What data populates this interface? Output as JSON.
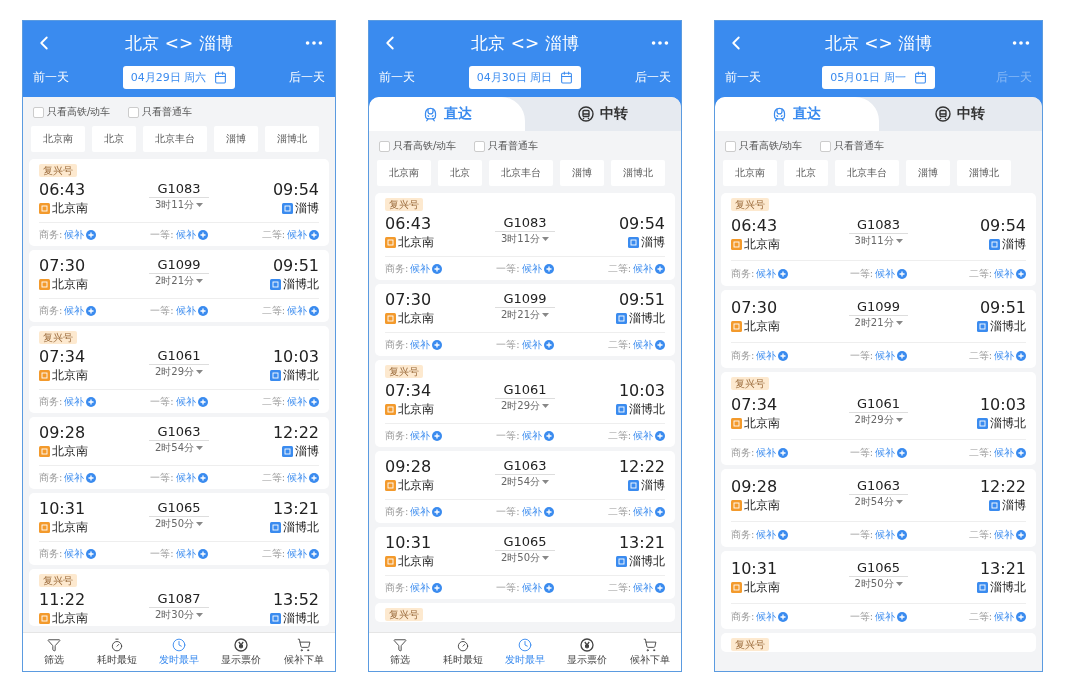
{
  "screens": [
    {
      "title": "北京 <> 淄博",
      "prev_day": {
        "label": "前一天",
        "disabled": false
      },
      "date": "04月29日 周六",
      "next_day": {
        "label": "后一天",
        "disabled": false
      },
      "filters": [
        {
          "label": "只看高铁/动车",
          "checked": false
        },
        {
          "label": "只看普通车",
          "checked": false
        }
      ],
      "stations": [
        "北京南",
        "北京",
        "北京丰台",
        "淄博",
        "淄博北"
      ],
      "trains": [
        {
          "badge": "复兴号",
          "depart": "06:43",
          "from": {
            "name": "北京南",
            "kind": "origin"
          },
          "number": "G1083",
          "duration": "3时11分",
          "arrive": "09:54",
          "to": {
            "name": "淄博",
            "kind": "pass"
          },
          "seats": [
            {
              "label": "商务:",
              "status": "候补"
            },
            {
              "label": "一等:",
              "status": "候补"
            },
            {
              "label": "二等:",
              "status": "候补"
            }
          ]
        },
        {
          "depart": "07:30",
          "from": {
            "name": "北京南",
            "kind": "origin"
          },
          "number": "G1099",
          "duration": "2时21分",
          "arrive": "09:51",
          "to": {
            "name": "淄博北",
            "kind": "pass"
          },
          "seats": [
            {
              "label": "商务:",
              "status": "候补"
            },
            {
              "label": "一等:",
              "status": "候补"
            },
            {
              "label": "二等:",
              "status": "候补"
            }
          ]
        },
        {
          "badge": "复兴号",
          "depart": "07:34",
          "from": {
            "name": "北京南",
            "kind": "origin"
          },
          "number": "G1061",
          "duration": "2时29分",
          "arrive": "10:03",
          "to": {
            "name": "淄博北",
            "kind": "pass"
          },
          "seats": [
            {
              "label": "商务:",
              "status": "候补"
            },
            {
              "label": "一等:",
              "status": "候补"
            },
            {
              "label": "二等:",
              "status": "候补"
            }
          ]
        },
        {
          "depart": "09:28",
          "from": {
            "name": "北京南",
            "kind": "origin"
          },
          "number": "G1063",
          "duration": "2时54分",
          "arrive": "12:22",
          "to": {
            "name": "淄博",
            "kind": "pass"
          },
          "seats": [
            {
              "label": "商务:",
              "status": "候补"
            },
            {
              "label": "一等:",
              "status": "候补"
            },
            {
              "label": "二等:",
              "status": "候补"
            }
          ]
        },
        {
          "depart": "10:31",
          "from": {
            "name": "北京南",
            "kind": "origin"
          },
          "number": "G1065",
          "duration": "2时50分",
          "arrive": "13:21",
          "to": {
            "name": "淄博北",
            "kind": "pass"
          },
          "seats": [
            {
              "label": "商务:",
              "status": "候补"
            },
            {
              "label": "一等:",
              "status": "候补"
            },
            {
              "label": "二等:",
              "status": "候补"
            }
          ]
        },
        {
          "badge": "复兴号",
          "depart": "11:22",
          "from": {
            "name": "北京南",
            "kind": "origin"
          },
          "number": "G1087",
          "duration": "2时30分",
          "arrive": "13:52",
          "to": {
            "name": "淄博北",
            "kind": "pass"
          }
        }
      ],
      "bottom_nav": [
        {
          "kind": "filter",
          "label": "筛选",
          "selected": false
        },
        {
          "kind": "duration",
          "label": "耗时最短",
          "selected": false
        },
        {
          "kind": "depart",
          "label": "发时最早",
          "selected": true
        },
        {
          "kind": "price",
          "label": "显示票价",
          "selected": false
        },
        {
          "kind": "cart",
          "label": "候补下单",
          "selected": false
        }
      ]
    },
    {
      "title": "北京 <> 淄博",
      "prev_day": {
        "label": "前一天",
        "disabled": false
      },
      "date": "04月30日 周日",
      "next_day": {
        "label": "后一天",
        "disabled": false
      },
      "tabs": [
        {
          "kind": "direct",
          "label": "直达",
          "selected": true
        },
        {
          "kind": "transfer",
          "label": "中转",
          "selected": false
        }
      ],
      "filters": [
        {
          "label": "只看高铁/动车",
          "checked": false
        },
        {
          "label": "只看普通车",
          "checked": false
        }
      ],
      "stations": [
        "北京南",
        "北京",
        "北京丰台",
        "淄博",
        "淄博北"
      ],
      "trains": [
        {
          "badge": "复兴号",
          "depart": "06:43",
          "from": {
            "name": "北京南",
            "kind": "origin"
          },
          "number": "G1083",
          "duration": "3时11分",
          "arrive": "09:54",
          "to": {
            "name": "淄博",
            "kind": "pass"
          },
          "seats": [
            {
              "label": "商务:",
              "status": "候补"
            },
            {
              "label": "一等:",
              "status": "候补"
            },
            {
              "label": "二等:",
              "status": "候补"
            }
          ]
        },
        {
          "depart": "07:30",
          "from": {
            "name": "北京南",
            "kind": "origin"
          },
          "number": "G1099",
          "duration": "2时21分",
          "arrive": "09:51",
          "to": {
            "name": "淄博北",
            "kind": "pass"
          },
          "seats": [
            {
              "label": "商务:",
              "status": "候补"
            },
            {
              "label": "一等:",
              "status": "候补"
            },
            {
              "label": "二等:",
              "status": "候补"
            }
          ]
        },
        {
          "badge": "复兴号",
          "depart": "07:34",
          "from": {
            "name": "北京南",
            "kind": "origin"
          },
          "number": "G1061",
          "duration": "2时29分",
          "arrive": "10:03",
          "to": {
            "name": "淄博北",
            "kind": "pass"
          },
          "seats": [
            {
              "label": "商务:",
              "status": "候补"
            },
            {
              "label": "一等:",
              "status": "候补"
            },
            {
              "label": "二等:",
              "status": "候补"
            }
          ]
        },
        {
          "depart": "09:28",
          "from": {
            "name": "北京南",
            "kind": "origin"
          },
          "number": "G1063",
          "duration": "2时54分",
          "arrive": "12:22",
          "to": {
            "name": "淄博",
            "kind": "pass"
          },
          "seats": [
            {
              "label": "商务:",
              "status": "候补"
            },
            {
              "label": "一等:",
              "status": "候补"
            },
            {
              "label": "二等:",
              "status": "候补"
            }
          ]
        },
        {
          "depart": "10:31",
          "from": {
            "name": "北京南",
            "kind": "origin"
          },
          "number": "G1065",
          "duration": "2时50分",
          "arrive": "13:21",
          "to": {
            "name": "淄博北",
            "kind": "pass"
          },
          "seats": [
            {
              "label": "商务:",
              "status": "候补"
            },
            {
              "label": "一等:",
              "status": "候补"
            },
            {
              "label": "二等:",
              "status": "候补"
            }
          ]
        },
        {
          "badge": "复兴号"
        }
      ],
      "bottom_nav": [
        {
          "kind": "filter",
          "label": "筛选",
          "selected": false
        },
        {
          "kind": "duration",
          "label": "耗时最短",
          "selected": false
        },
        {
          "kind": "depart",
          "label": "发时最早",
          "selected": true
        },
        {
          "kind": "price",
          "label": "显示票价",
          "selected": false
        },
        {
          "kind": "cart",
          "label": "候补下单",
          "selected": false
        }
      ]
    },
    {
      "title": "北京 <> 淄博",
      "prev_day": {
        "label": "前一天",
        "disabled": false
      },
      "date": "05月01日 周一",
      "next_day": {
        "label": "后一天",
        "disabled": true
      },
      "tabs": [
        {
          "kind": "direct",
          "label": "直达",
          "selected": true
        },
        {
          "kind": "transfer",
          "label": "中转",
          "selected": false
        }
      ],
      "filters": [
        {
          "label": "只看高铁/动车",
          "checked": false
        },
        {
          "label": "只看普通车",
          "checked": false
        }
      ],
      "stations": [
        "北京南",
        "北京",
        "北京丰台",
        "淄博",
        "淄博北"
      ],
      "trains": [
        {
          "badge": "复兴号",
          "depart": "06:43",
          "from": {
            "name": "北京南",
            "kind": "origin"
          },
          "number": "G1083",
          "duration": "3时11分",
          "arrive": "09:54",
          "to": {
            "name": "淄博",
            "kind": "pass"
          },
          "seats": [
            {
              "label": "商务:",
              "status": "候补"
            },
            {
              "label": "一等:",
              "status": "候补"
            },
            {
              "label": "二等:",
              "status": "候补"
            }
          ]
        },
        {
          "depart": "07:30",
          "from": {
            "name": "北京南",
            "kind": "origin"
          },
          "number": "G1099",
          "duration": "2时21分",
          "arrive": "09:51",
          "to": {
            "name": "淄博北",
            "kind": "pass"
          },
          "seats": [
            {
              "label": "商务:",
              "status": "候补"
            },
            {
              "label": "一等:",
              "status": "候补"
            },
            {
              "label": "二等:",
              "status": "候补"
            }
          ]
        },
        {
          "badge": "复兴号",
          "depart": "07:34",
          "from": {
            "name": "北京南",
            "kind": "origin"
          },
          "number": "G1061",
          "duration": "2时29分",
          "arrive": "10:03",
          "to": {
            "name": "淄博北",
            "kind": "pass"
          },
          "seats": [
            {
              "label": "商务:",
              "status": "候补"
            },
            {
              "label": "一等:",
              "status": "候补"
            },
            {
              "label": "二等:",
              "status": "候补"
            }
          ]
        },
        {
          "depart": "09:28",
          "from": {
            "name": "北京南",
            "kind": "origin"
          },
          "number": "G1063",
          "duration": "2时54分",
          "arrive": "12:22",
          "to": {
            "name": "淄博",
            "kind": "pass"
          },
          "seats": [
            {
              "label": "商务:",
              "status": "候补"
            },
            {
              "label": "一等:",
              "status": "候补"
            },
            {
              "label": "二等:",
              "status": "候补"
            }
          ]
        },
        {
          "depart": "10:31",
          "from": {
            "name": "北京南",
            "kind": "origin"
          },
          "number": "G1065",
          "duration": "2时50分",
          "arrive": "13:21",
          "to": {
            "name": "淄博北",
            "kind": "pass"
          },
          "seats": [
            {
              "label": "商务:",
              "status": "候补"
            },
            {
              "label": "一等:",
              "status": "候补"
            },
            {
              "label": "二等:",
              "status": "候补"
            }
          ]
        },
        {
          "badge": "复兴号"
        }
      ]
    }
  ]
}
